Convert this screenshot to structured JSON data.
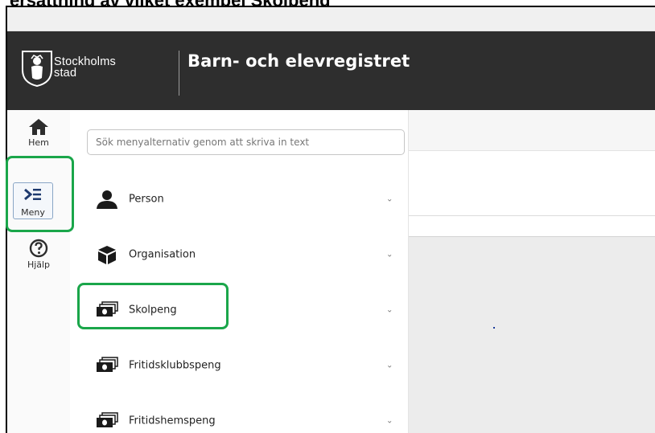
{
  "caption": "ersättning av vilket exempel Skolpeng",
  "header": {
    "brand_line1": "Stockholms",
    "brand_line2": "stad",
    "app_title": "Barn- och elevregistret"
  },
  "leftnav": {
    "items": [
      {
        "label": "Hem",
        "icon": "home-icon"
      },
      {
        "label": "Meny",
        "icon": "menu-icon"
      },
      {
        "label": "Hjälp",
        "icon": "help-icon"
      }
    ]
  },
  "menu": {
    "search_placeholder": "Sök menyalternativ genom att skriva in text",
    "items": [
      {
        "label": "Person",
        "icon": "person-icon"
      },
      {
        "label": "Organisation",
        "icon": "cube-icon"
      },
      {
        "label": "Skolpeng",
        "icon": "money-icon"
      },
      {
        "label": "Fritidsklubbspeng",
        "icon": "money-icon"
      },
      {
        "label": "Fritidshemspeng",
        "icon": "money-icon"
      }
    ],
    "chevron": "⌄"
  },
  "colors": {
    "header_bg": "#2e2e2e",
    "highlight": "#1aa64a"
  }
}
